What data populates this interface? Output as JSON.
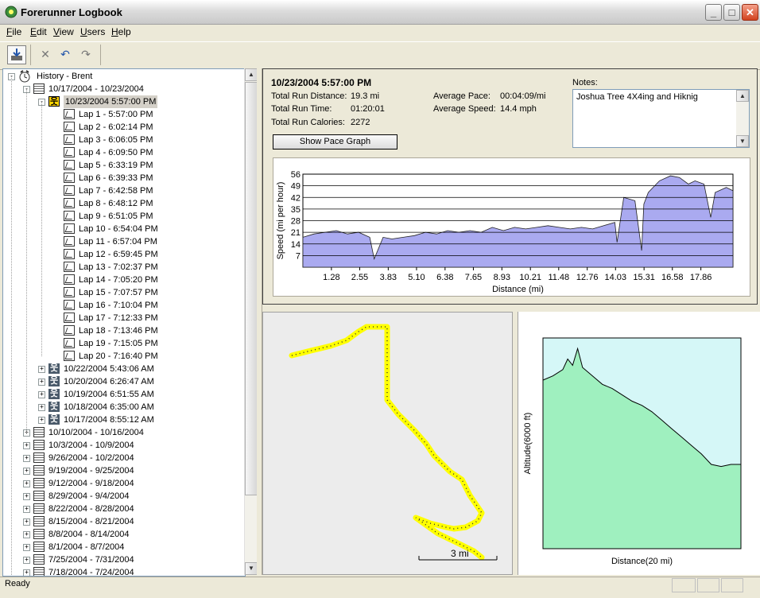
{
  "window": {
    "title": "Forerunner Logbook"
  },
  "menu": [
    {
      "label": "File",
      "u": "F",
      "rest": "ile"
    },
    {
      "label": "Edit",
      "u": "E",
      "rest": "dit"
    },
    {
      "label": "View",
      "u": "V",
      "rest": "iew"
    },
    {
      "label": "Users",
      "u": "U",
      "rest": "sers"
    },
    {
      "label": "Help",
      "u": "H",
      "rest": "elp"
    }
  ],
  "toolbar": {
    "icons": [
      "import-icon",
      "delete-icon",
      "undo-icon",
      "redo-icon"
    ]
  },
  "tree": {
    "root": "History - Brent",
    "selected_week": "10/17/2004 - 10/23/2004",
    "selected_run": "10/23/2004 5:57:00 PM",
    "laps": [
      "Lap 1 - 5:57:00 PM",
      "Lap 2 - 6:02:14 PM",
      "Lap 3 - 6:06:05 PM",
      "Lap 4 - 6:09:50 PM",
      "Lap 5 - 6:33:19 PM",
      "Lap 6 - 6:39:33 PM",
      "Lap 7 - 6:42:58 PM",
      "Lap 8 - 6:48:12 PM",
      "Lap 9 - 6:51:05 PM",
      "Lap 10 - 6:54:04 PM",
      "Lap 11 - 6:57:04 PM",
      "Lap 12 - 6:59:45 PM",
      "Lap 13 - 7:02:37 PM",
      "Lap 14 - 7:05:20 PM",
      "Lap 15 - 7:07:57 PM",
      "Lap 16 - 7:10:04 PM",
      "Lap 17 - 7:12:33 PM",
      "Lap 18 - 7:13:46 PM",
      "Lap 19 - 7:15:05 PM",
      "Lap 20 - 7:16:40 PM"
    ],
    "other_runs": [
      "10/22/2004 5:43:06 AM",
      "10/20/2004 6:26:47 AM",
      "10/19/2004 6:51:55 AM",
      "10/18/2004 6:35:00 AM",
      "10/17/2004 8:55:12 AM"
    ],
    "other_weeks": [
      "10/10/2004 - 10/16/2004",
      "10/3/2004 - 10/9/2004",
      "9/26/2004 - 10/2/2004",
      "9/19/2004 - 9/25/2004",
      "9/12/2004 - 9/18/2004",
      "8/29/2004 - 9/4/2004",
      "8/22/2004 - 8/28/2004",
      "8/15/2004 - 8/21/2004",
      "8/8/2004 - 8/14/2004",
      "8/1/2004 - 8/7/2004",
      "7/25/2004 - 7/31/2004",
      "7/18/2004 - 7/24/2004"
    ]
  },
  "run": {
    "title": "10/23/2004  5:57:00 PM",
    "distance_label": "Total Run Distance:",
    "distance": "19.3 mi",
    "time_label": "Total Run Time:",
    "time": "01:20:01",
    "calories_label": "Total Run Calories:",
    "calories": "2272",
    "pace_label": "Average Pace:",
    "pace": "00:04:09/mi",
    "speed_label": "Average Speed:",
    "speed": "14.4 mph",
    "notes_label": "Notes:",
    "notes": "Joshua Tree 4X4ing and Hiknig",
    "pace_button": "Show Pace Graph"
  },
  "chart_data": [
    {
      "type": "area",
      "ylabel": "Speed (mi per hour)",
      "xlabel": "Distance (mi)",
      "yticks": [
        7,
        14,
        21,
        28,
        35,
        42,
        49,
        56
      ],
      "xticks": [
        "1.28",
        "2.55",
        "3.83",
        "5.10",
        "6.38",
        "7.65",
        "8.93",
        "10.21",
        "11.48",
        "12.76",
        "14.03",
        "15.31",
        "16.58",
        "17.86"
      ],
      "xlim": [
        0,
        19.3
      ],
      "ylim": [
        0,
        56
      ],
      "x": [
        0,
        0.5,
        1.0,
        1.5,
        2.0,
        2.5,
        3.0,
        3.2,
        3.6,
        4.0,
        4.5,
        5.0,
        5.5,
        6.0,
        6.5,
        7.0,
        7.5,
        8.0,
        8.5,
        9.0,
        9.5,
        10.0,
        10.5,
        11.0,
        11.5,
        12.0,
        12.5,
        13.0,
        13.5,
        14.0,
        14.1,
        14.4,
        14.9,
        15.2,
        15.3,
        15.5,
        16.0,
        16.5,
        16.9,
        17.3,
        17.6,
        18.0,
        18.3,
        18.5,
        19.0,
        19.3
      ],
      "values": [
        18,
        20,
        21,
        22,
        20,
        21,
        18,
        5,
        18,
        17,
        18,
        19,
        21,
        20,
        22,
        21,
        22,
        21,
        24,
        22,
        24,
        23,
        24,
        25,
        24,
        23,
        24,
        23,
        25,
        27,
        15,
        42,
        40,
        10,
        38,
        45,
        52,
        55,
        54,
        50,
        52,
        50,
        30,
        45,
        48,
        46
      ]
    },
    {
      "type": "area",
      "ylabel": "Altitude(6000 ft)",
      "xlabel": "Distance(20 mi)",
      "x": [
        0,
        1,
        2,
        2.5,
        3,
        3.5,
        4,
        5,
        6,
        7,
        8,
        9,
        10,
        11,
        12,
        13,
        14,
        15,
        16,
        17,
        18,
        19,
        20
      ],
      "values": [
        0.8,
        0.82,
        0.85,
        0.9,
        0.87,
        0.95,
        0.86,
        0.82,
        0.78,
        0.76,
        0.73,
        0.7,
        0.68,
        0.65,
        0.61,
        0.57,
        0.53,
        0.49,
        0.45,
        0.4,
        0.39,
        0.4,
        0.4
      ],
      "ylim": [
        0,
        1
      ]
    }
  ],
  "map": {
    "scale_label": "3 mi",
    "track_color": "#ffff00"
  },
  "status": {
    "text": "Ready"
  }
}
